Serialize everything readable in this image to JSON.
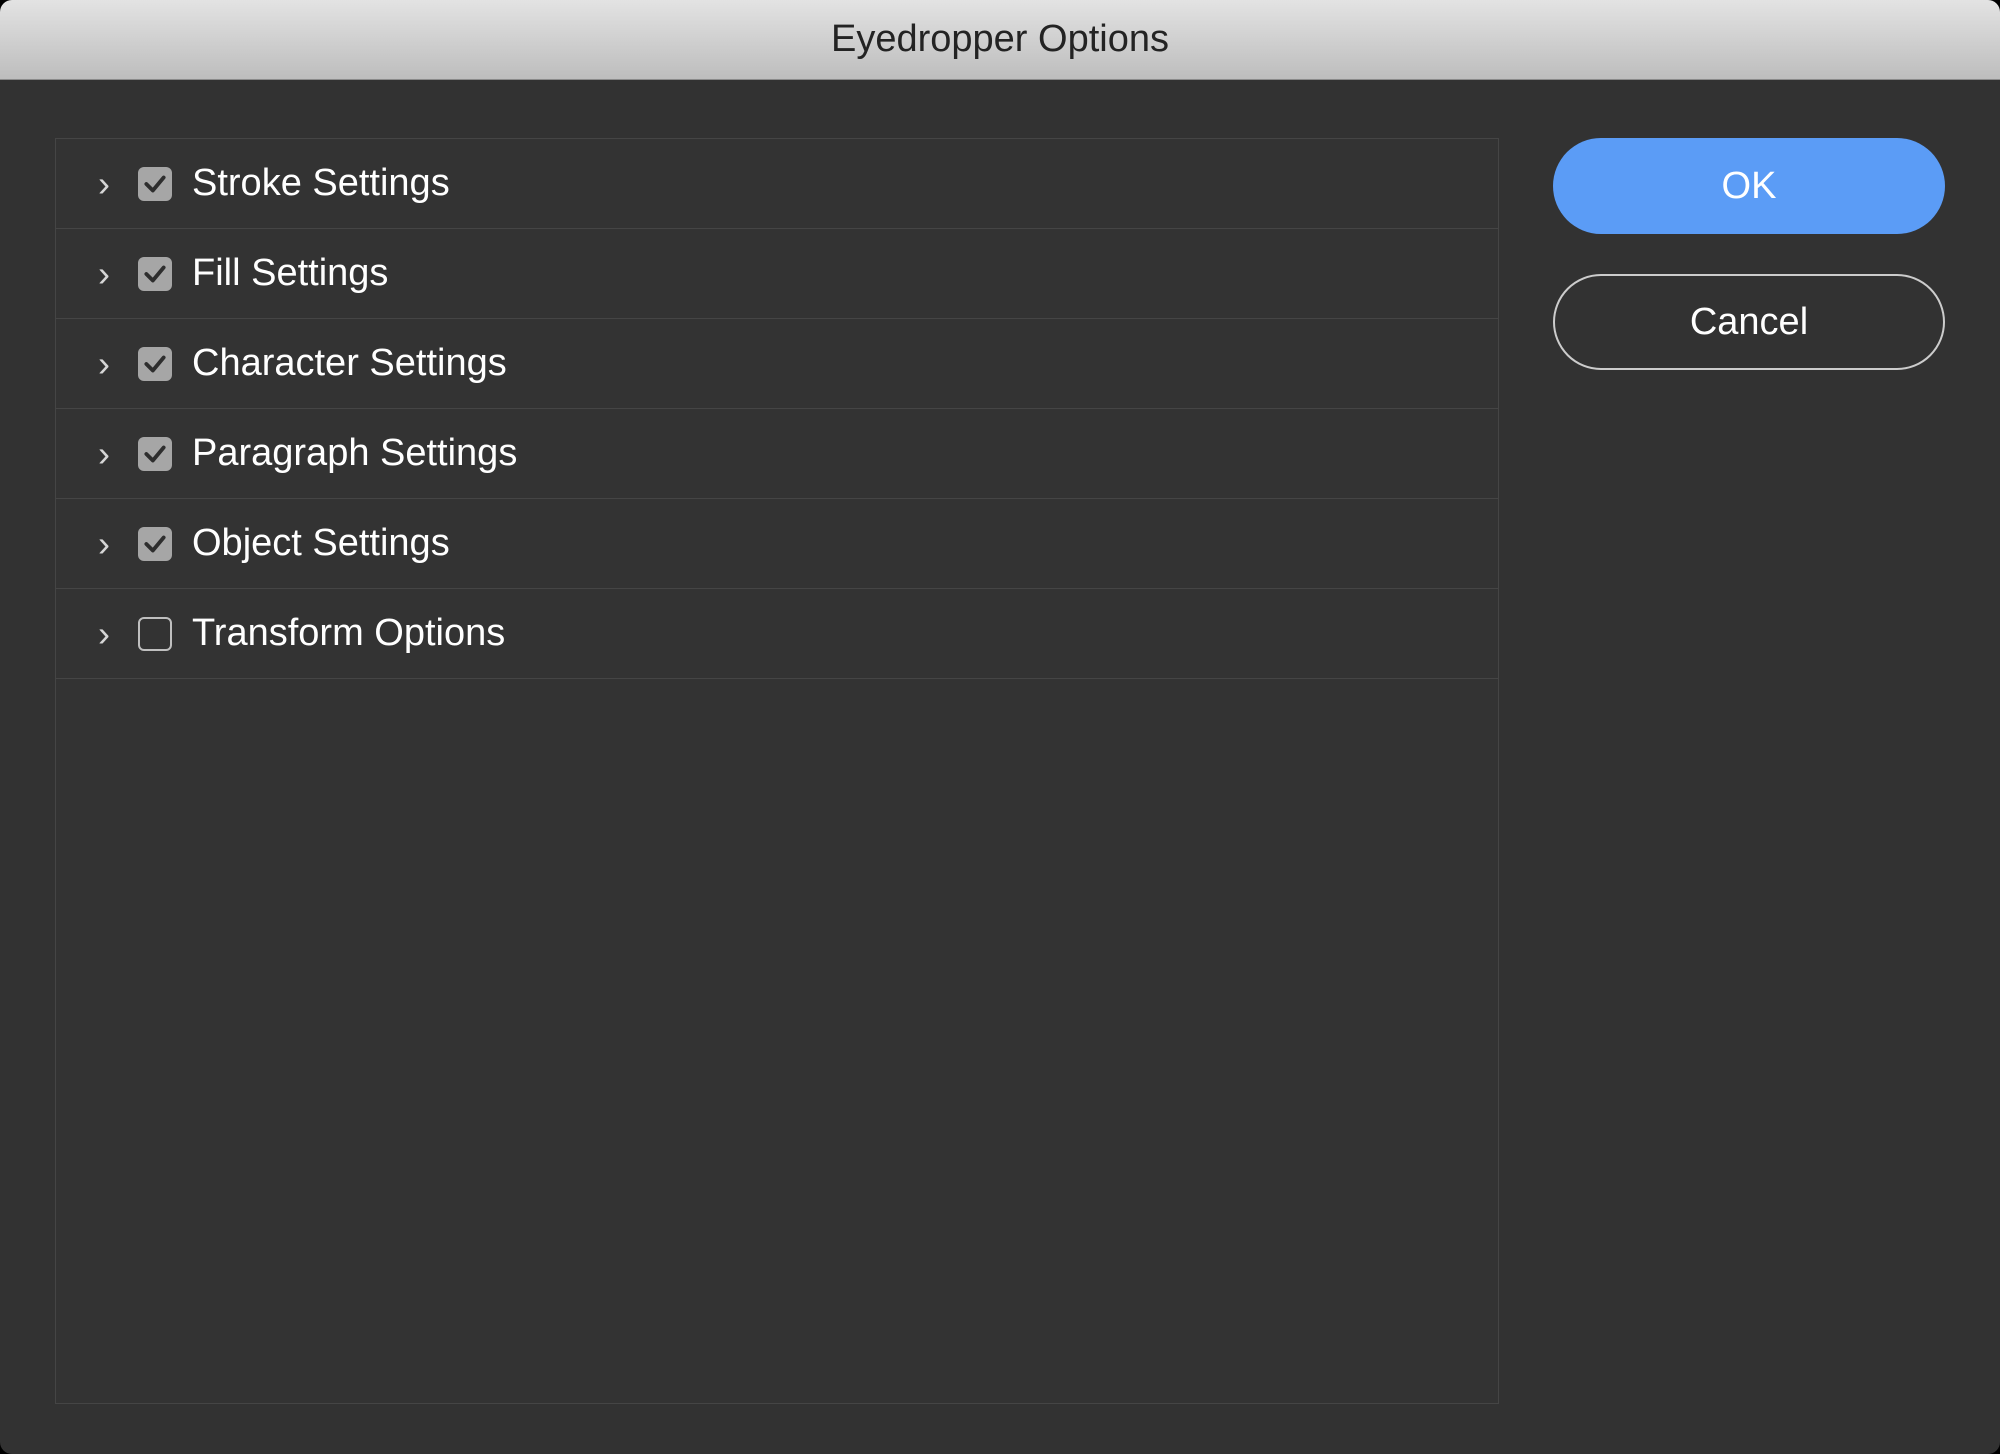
{
  "title": "Eyedropper Options",
  "options": [
    {
      "label": "Stroke Settings",
      "checked": true
    },
    {
      "label": "Fill Settings",
      "checked": true
    },
    {
      "label": "Character Settings",
      "checked": true
    },
    {
      "label": "Paragraph Settings",
      "checked": true
    },
    {
      "label": "Object Settings",
      "checked": true
    },
    {
      "label": "Transform Options",
      "checked": false
    }
  ],
  "buttons": {
    "ok": "OK",
    "cancel": "Cancel"
  }
}
